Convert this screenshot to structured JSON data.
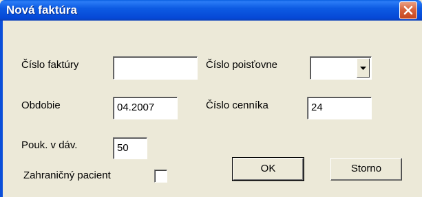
{
  "window": {
    "title": "Nová faktúra",
    "close_icon": "close-icon"
  },
  "form": {
    "invoice_number": {
      "label": "Číslo faktúry",
      "value": ""
    },
    "insurer_number": {
      "label": "Číslo poisťovne",
      "value": ""
    },
    "period": {
      "label": "Obdobie",
      "value": "04.2007"
    },
    "price_list_number": {
      "label": "Číslo cenníka",
      "value": "24"
    },
    "vouchers_in_batch": {
      "label": "Pouk. v dáv.",
      "value": "50"
    },
    "foreign_patient": {
      "label": "Zahraničný pacient",
      "checked": false
    }
  },
  "buttons": {
    "ok_label": "OK",
    "cancel_label": "Storno"
  }
}
